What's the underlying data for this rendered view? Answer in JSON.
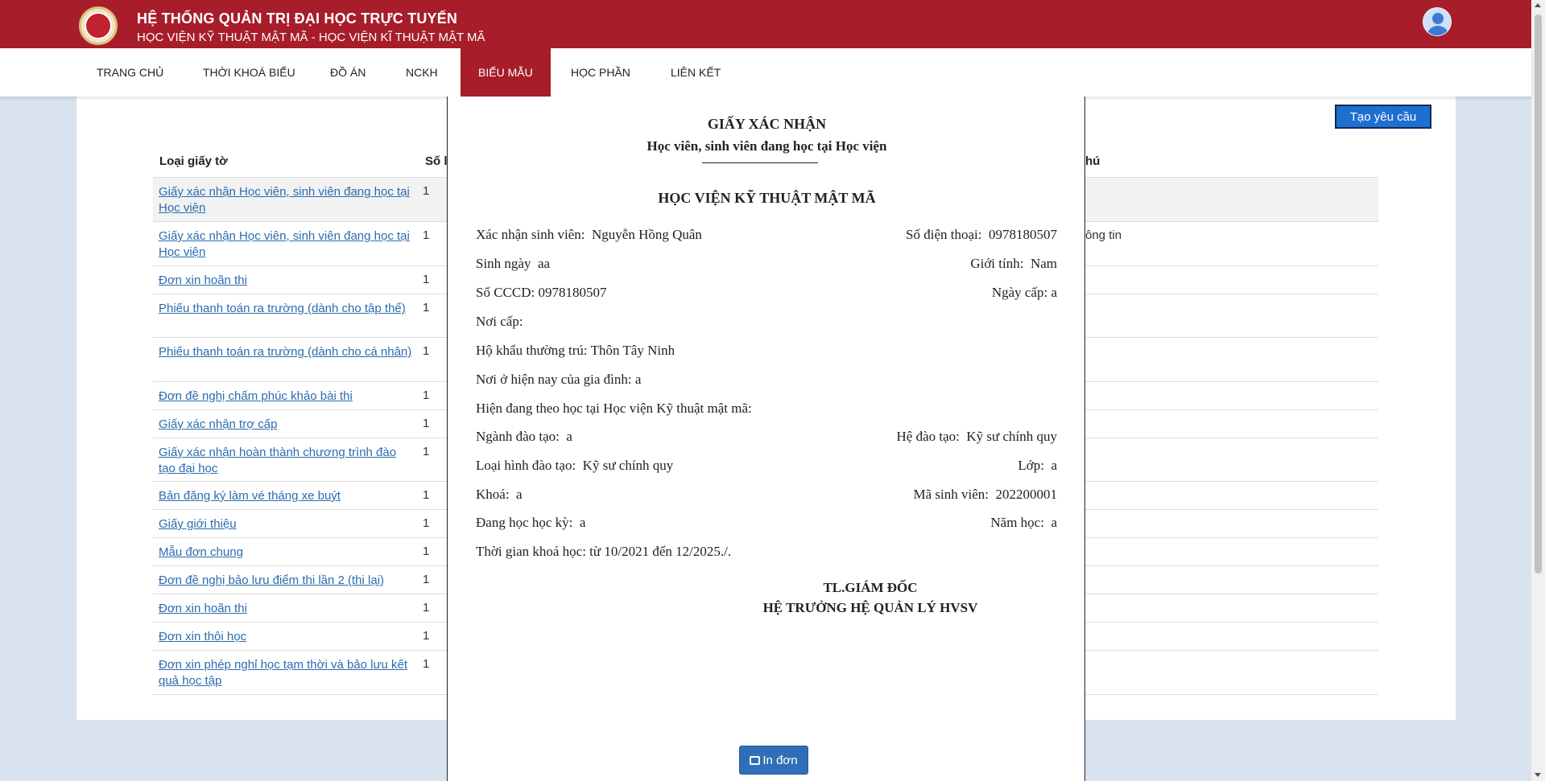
{
  "header": {
    "title": "HỆ THỐNG QUẢN TRỊ ĐẠI HỌC TRỰC TUYẾN",
    "subtitle": "HỌC VIỆN KỸ THUẬT MẬT MÃ - HỌC VIỆN KĨ THUẬT MẬT MÃ"
  },
  "nav": {
    "items": [
      "TRANG CHỦ",
      "THỜI KHOÁ BIỂU",
      "ĐỒ ÁN",
      "NCKH",
      "BIỂU MẪU",
      "HỌC PHẦN",
      "LIÊN KẾT"
    ],
    "active": "BIỂU MẪU"
  },
  "page": {
    "create_button": "Tạo yêu cầu",
    "columns": [
      "Loại giấy tờ",
      "Số lư",
      "hú"
    ],
    "note_fragment": "ông tin",
    "rows": [
      {
        "name": "Giấy xác nhận Học viên, sinh viên đang học tại Học viện",
        "qty": "1"
      },
      {
        "name": "Giấy xác nhận Học viên, sinh viên đang học tại Học viện",
        "qty": "1"
      },
      {
        "name": "Đơn xin hoãn thi",
        "qty": "1"
      },
      {
        "name": "Phiếu thanh toán ra trường (dành cho tập thể)",
        "qty": "1"
      },
      {
        "name": "Phiếu thanh toán ra trường (dành cho cá nhân)",
        "qty": "1"
      },
      {
        "name": "Đơn đề nghị chấm phúc khảo bài thi",
        "qty": "1"
      },
      {
        "name": "Giấy xác nhận trợ cấp",
        "qty": "1"
      },
      {
        "name": "Giấy xác nhận hoàn thành chương trình đào tạo đại học",
        "qty": "1"
      },
      {
        "name": "Bản đăng ký làm vé tháng xe buýt",
        "qty": "1"
      },
      {
        "name": "Giấy giới thiệu",
        "qty": "1"
      },
      {
        "name": "Mẫu đơn chung",
        "qty": "1"
      },
      {
        "name": "Đơn đề nghị bảo lưu điểm thi lần 2 (thi lại)",
        "qty": "1"
      },
      {
        "name": "Đơn xin hoãn thi",
        "qty": "1"
      },
      {
        "name": "Đơn xin thôi học",
        "qty": "1"
      },
      {
        "name": "Đơn xin phép nghỉ học tạm thời và bảo lưu kết quả học tập",
        "qty": "1"
      }
    ]
  },
  "document": {
    "title": "GIẤY XÁC NHẬN",
    "subtitle": "Học viên, sinh viên đang học tại Học viện",
    "institution": "HỌC VIỆN KỸ THUẬT MẬT MÃ",
    "student_label": "Xác nhận sinh viên:",
    "student_name": "Nguyễn Hồng Quân",
    "phone_label": "Số điện thoại:",
    "phone": "0978180507",
    "dob_label": "Sinh ngày",
    "dob": "aa",
    "gender_label": "Giới tính:",
    "gender": "Nam",
    "id_label": "Số CCCD:",
    "id_number": "0978180507",
    "issue_date_label": "Ngày cấp:",
    "issue_date": "a",
    "issue_place_label": "Nơi cấp:",
    "residence_label": "Hộ khẩu thường trú:",
    "residence": "Thôn Tây Ninh",
    "current_address_label": "Nơi ở hiện nay của gia đình:",
    "current_address": "a",
    "studying_line": "Hiện đang theo học tại Học viện Kỹ thuật mật mã:",
    "major_label": "Ngành đào tạo:",
    "major": "a",
    "system_label": "Hệ đào tạo:",
    "system": "Kỹ sư chính quy",
    "type_label": "Loại hình đào tạo:",
    "type": "Kỹ sư chính quy",
    "class_label": "Lớp:",
    "class": "a",
    "cohort_label": "Khoá:",
    "cohort": "a",
    "student_id_label": "Mã sinh viên:",
    "student_id": "202200001",
    "semester_label": "Đang học học kỳ:",
    "semester": "a",
    "year_label": "Năm học:",
    "year": "a",
    "duration": "Thời gian khoá học: từ 10/2021 đến 12/2025./.",
    "signature_1": "TL.GIÁM ĐỐC",
    "signature_2": "HỆ TRƯỞNG HỆ QUẢN LÝ HVSV"
  },
  "print_button": "In đơn",
  "colors": {
    "brand": "#a71d2a",
    "link": "#2b6cb0",
    "button": "#1e6fd0"
  }
}
